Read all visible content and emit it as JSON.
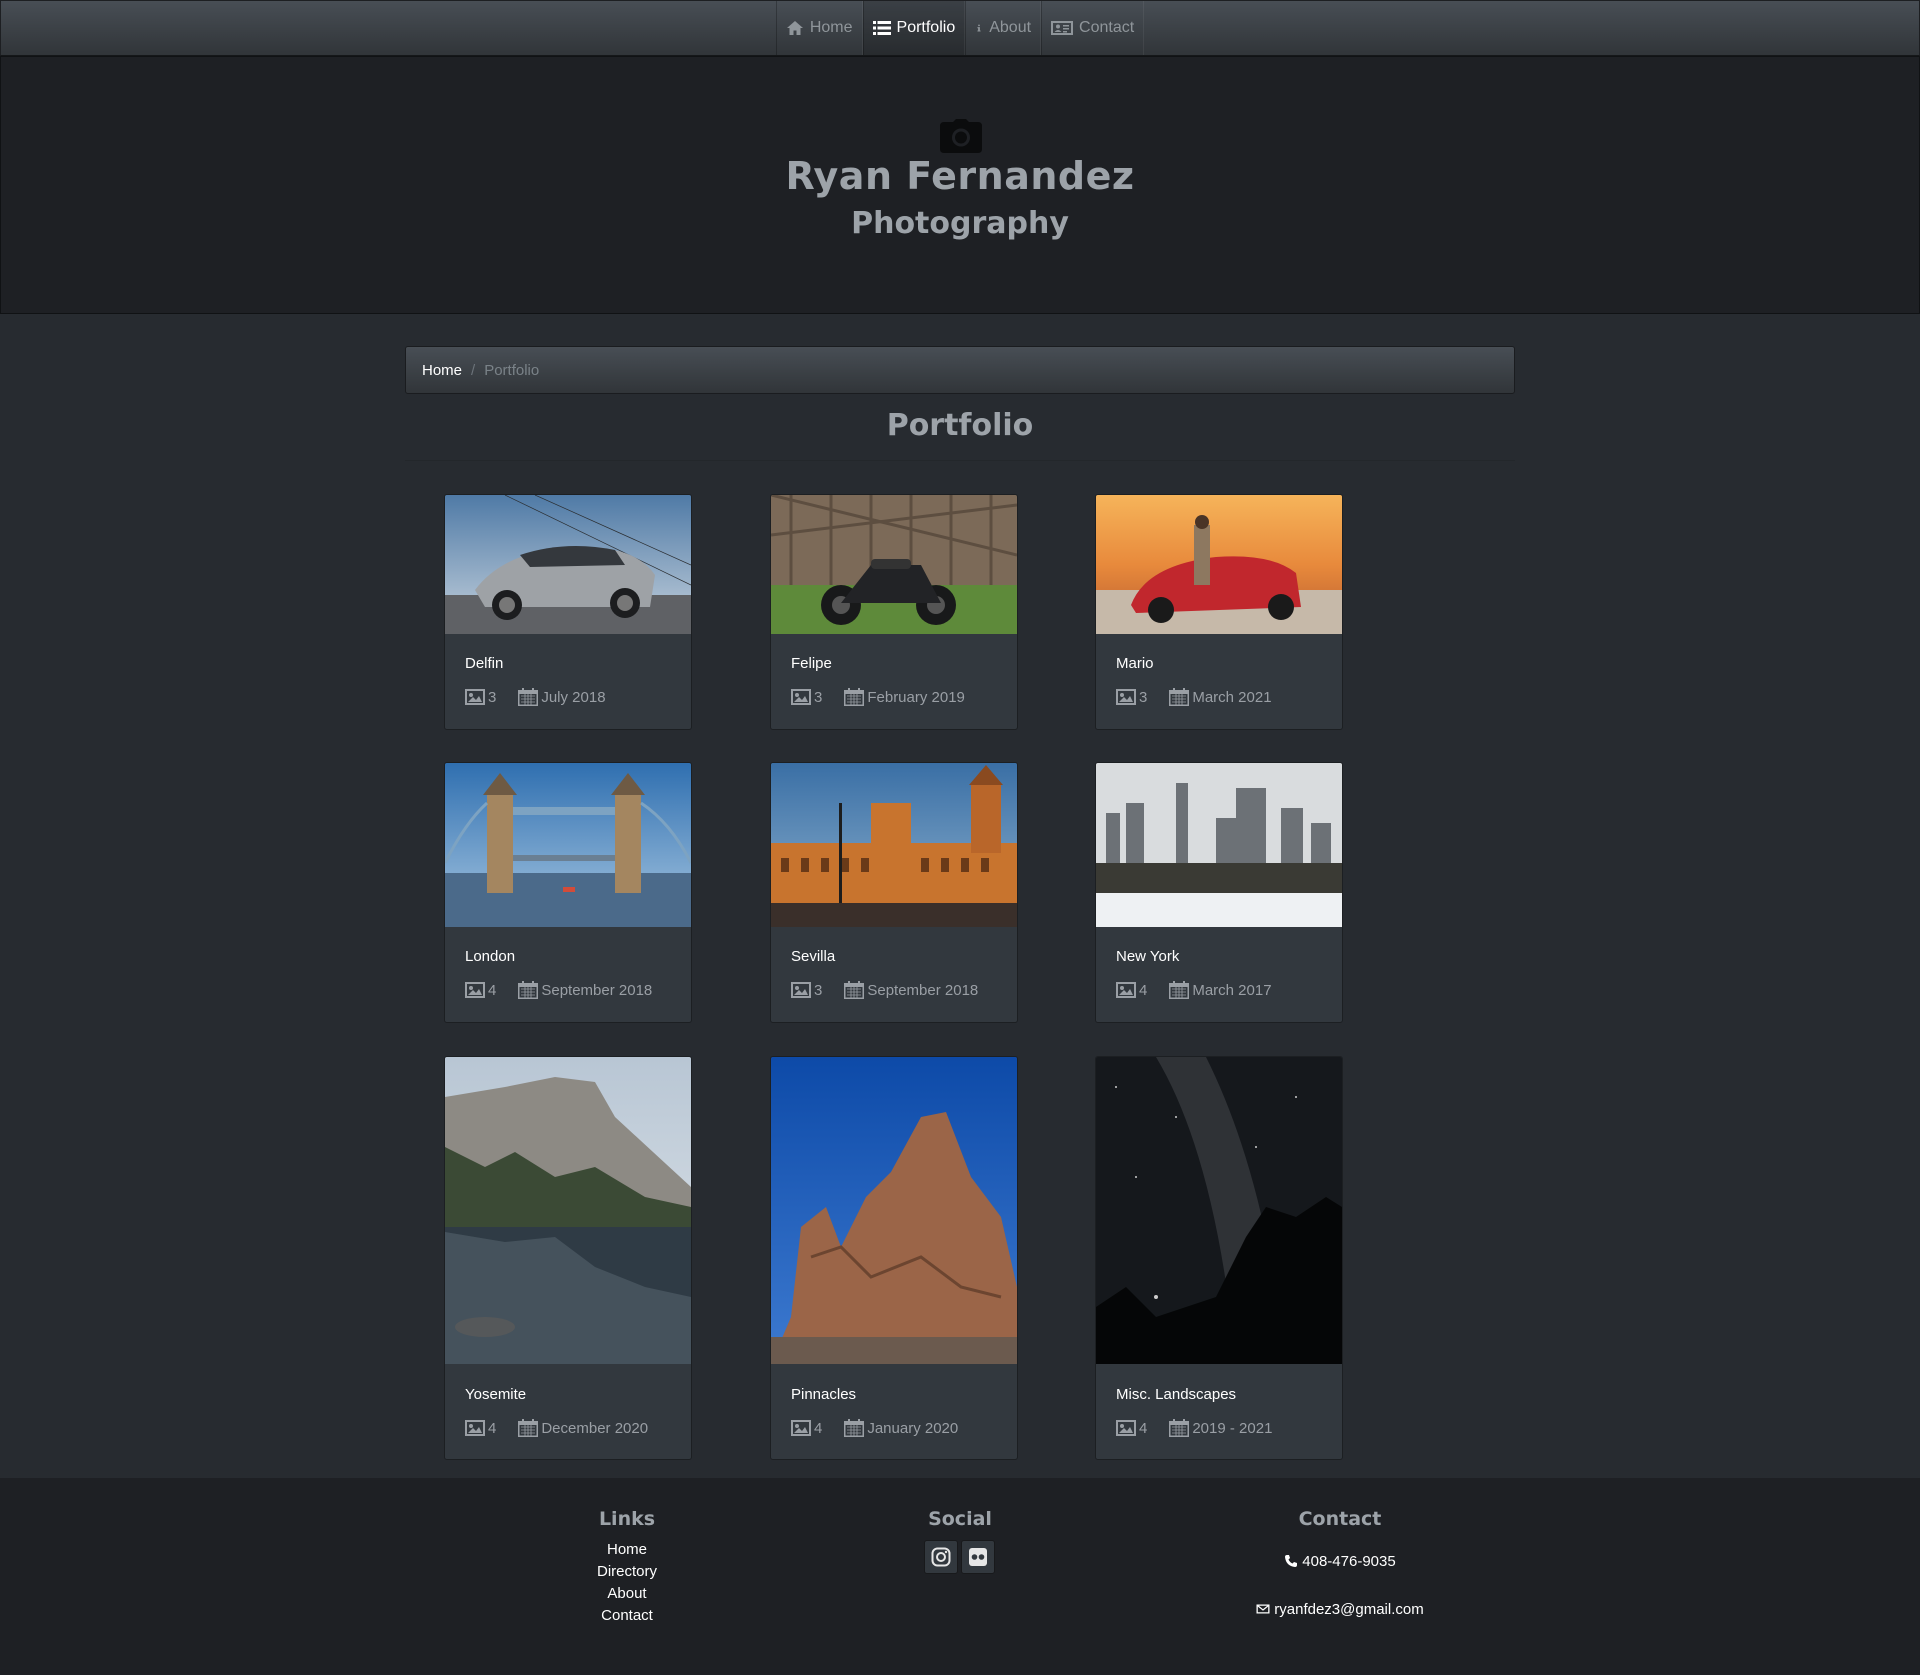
{
  "nav": {
    "items": [
      {
        "label": "Home",
        "icon": "home-icon"
      },
      {
        "label": "Portfolio",
        "icon": "list-icon",
        "active": true
      },
      {
        "label": "About",
        "icon": "info-icon"
      },
      {
        "label": "Contact",
        "icon": "id-card-icon"
      }
    ]
  },
  "hero": {
    "icon": "camera-icon",
    "name": "Ryan Fernandez",
    "subtitle": "Photography"
  },
  "breadcrumb": {
    "home": "Home",
    "separator": "/",
    "current": "Portfolio"
  },
  "page_title": "Portfolio",
  "albums": [
    {
      "title": "Delfin",
      "count": "3",
      "date": "July 2018",
      "photo": "silver sports sedan"
    },
    {
      "title": "Felipe",
      "count": "3",
      "date": "February 2019",
      "photo": "motorcycle on grass"
    },
    {
      "title": "Mario",
      "count": "3",
      "date": "March 2021",
      "photo": "red car at sunset"
    },
    {
      "title": "London",
      "count": "4",
      "date": "September 2018",
      "photo": "tower bridge"
    },
    {
      "title": "Sevilla",
      "count": "3",
      "date": "September 2018",
      "photo": "plaza de españa"
    },
    {
      "title": "New York",
      "count": "4",
      "date": "March 2017",
      "photo": "central park skyline"
    },
    {
      "title": "Yosemite",
      "count": "4",
      "date": "December 2020",
      "photo": "el capitan reflection"
    },
    {
      "title": "Pinnacles",
      "count": "4",
      "date": "January 2020",
      "photo": "rock formations"
    },
    {
      "title": "Misc. Landscapes",
      "count": "4",
      "date": "2019 - 2021",
      "photo": "milky way"
    }
  ],
  "footer": {
    "links_heading": "Links",
    "links": [
      "Home",
      "Directory",
      "About",
      "Contact"
    ],
    "social_heading": "Social",
    "social": [
      {
        "icon": "instagram-icon"
      },
      {
        "icon": "flickr-icon"
      }
    ],
    "contact_heading": "Contact",
    "phone": "408-476-9035",
    "email": "ryanfdez3@gmail.com"
  }
}
